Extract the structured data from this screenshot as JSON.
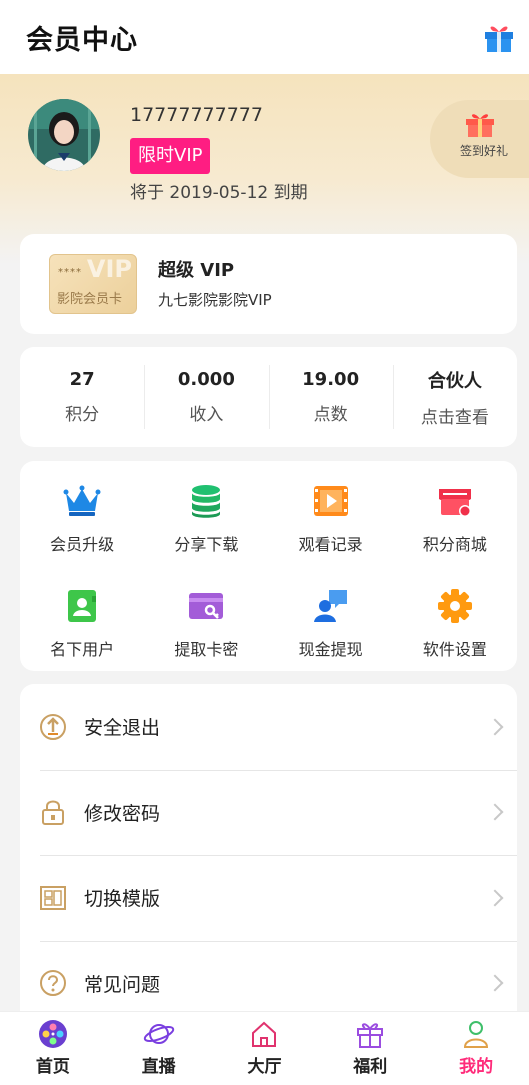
{
  "header": {
    "title": "会员中心",
    "gift_icon": "gift-box-icon"
  },
  "profile": {
    "phone": "17777777777",
    "vip_tag": "限时VIP",
    "expire_text": "将于 2019-05-12 到期",
    "sign_in_label": "签到好礼",
    "sign_in_icon": "gift-icon"
  },
  "vip_card": {
    "badge_stars": "****",
    "badge_big": "VIP",
    "badge_text": "影院会员卡",
    "name": "超级 VIP",
    "desc": "九七影院影院VIP"
  },
  "stats": [
    {
      "value": "27",
      "label": "积分"
    },
    {
      "value": "0.000",
      "label": "收入"
    },
    {
      "value": "19.00",
      "label": "点数"
    },
    {
      "value": "合伙人",
      "label": "点击查看"
    }
  ],
  "grid": [
    {
      "label": "会员升级",
      "icon": "crown-icon",
      "color": "#1e88e5"
    },
    {
      "label": "分享下载",
      "icon": "database-icon",
      "color": "#20c070"
    },
    {
      "label": "观看记录",
      "icon": "film-icon",
      "color": "#ff8a1a"
    },
    {
      "label": "积分商城",
      "icon": "store-icon",
      "color": "#f0304a"
    },
    {
      "label": "名下用户",
      "icon": "contacts-icon",
      "color": "#3ec64a"
    },
    {
      "label": "提取卡密",
      "icon": "key-card-icon",
      "color": "#a35cd8"
    },
    {
      "label": "现金提现",
      "icon": "user-chat-icon",
      "color": "#1e6ee0"
    },
    {
      "label": "软件设置",
      "icon": "gear-icon",
      "color": "#ff9a10"
    }
  ],
  "menu": [
    {
      "label": "安全退出",
      "icon": "logout-icon"
    },
    {
      "label": "修改密码",
      "icon": "lock-icon"
    },
    {
      "label": "切换模版",
      "icon": "template-icon"
    },
    {
      "label": "常见问题",
      "icon": "question-icon"
    }
  ],
  "tabs": [
    {
      "label": "首页",
      "icon": "film-reel-icon"
    },
    {
      "label": "直播",
      "icon": "planet-icon"
    },
    {
      "label": "大厅",
      "icon": "home-icon"
    },
    {
      "label": "福利",
      "icon": "gift-icon"
    },
    {
      "label": "我的",
      "icon": "user-icon",
      "active": true
    }
  ],
  "colors": {
    "accent": "#ff2b7a",
    "vip_tag": "#ff1d82",
    "gold": "#c9a063"
  }
}
